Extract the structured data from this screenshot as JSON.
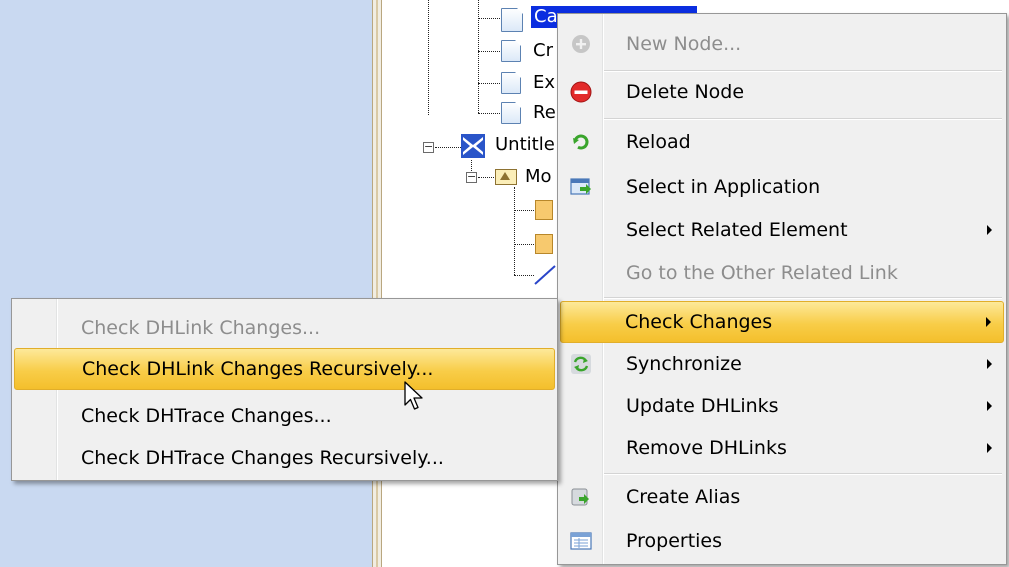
{
  "tree": {
    "nodes": [
      {
        "id": "selected-node",
        "label": "Ca"
      },
      {
        "id": "cr-node",
        "label": "Cr"
      },
      {
        "id": "ex-node",
        "label": "Ex"
      },
      {
        "id": "re-node",
        "label": "Re"
      },
      {
        "id": "untitled-node",
        "label": "Untitle"
      },
      {
        "id": "model-node",
        "label": "Mo"
      }
    ]
  },
  "context_menu": {
    "items": [
      {
        "label": "New Node...",
        "icon": "add-icon",
        "disabled": true
      },
      {
        "label": "Delete Node",
        "icon": "delete-icon"
      },
      {
        "label": "Reload",
        "icon": "reload-icon"
      },
      {
        "label": "Select in Application",
        "icon": "select-in-application-icon"
      },
      {
        "label": "Select Related Element",
        "submenu": true
      },
      {
        "label": "Go to the Other Related Link",
        "disabled": true
      },
      {
        "label": "Check Changes",
        "submenu": true,
        "highlighted": true
      },
      {
        "label": "Synchronize",
        "icon": "synchronize-icon",
        "submenu": true
      },
      {
        "label": "Update DHLinks",
        "submenu": true
      },
      {
        "label": "Remove DHLinks",
        "submenu": true
      },
      {
        "label": "Create Alias",
        "icon": "create-alias-icon"
      },
      {
        "label": "Properties",
        "icon": "properties-icon"
      }
    ]
  },
  "submenu": {
    "items": [
      {
        "label": "Check DHLink Changes...",
        "disabled": true
      },
      {
        "label": "Check DHLink Changes Recursively...",
        "highlighted": true
      },
      {
        "label": "Check DHTrace Changes..."
      },
      {
        "label": "Check DHTrace Changes Recursively..."
      }
    ]
  },
  "colors": {
    "highlight": "#f8cd48",
    "selection": "#0b2ee0",
    "left_pane": "#c9d9f1",
    "menu_background": "#f0f0f0"
  }
}
